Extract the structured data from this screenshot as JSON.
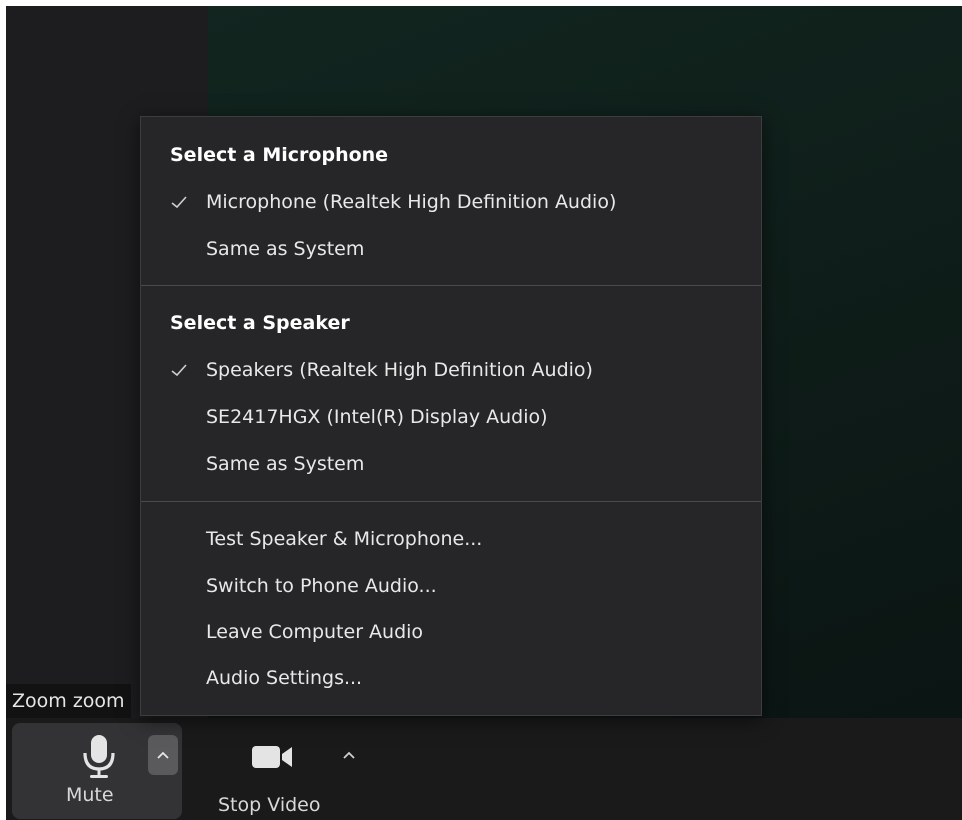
{
  "participant": {
    "name": "Zoom zoom"
  },
  "toolbar": {
    "mute_label": "Mute",
    "stop_video_label": "Stop Video"
  },
  "audio_menu": {
    "microphone_section": {
      "heading": "Select a Microphone",
      "items": [
        {
          "label": "Microphone (Realtek High Definition Audio)",
          "selected": true
        },
        {
          "label": "Same as System",
          "selected": false
        }
      ]
    },
    "speaker_section": {
      "heading": "Select a Speaker",
      "items": [
        {
          "label": "Speakers (Realtek High Definition Audio)",
          "selected": true
        },
        {
          "label": "SE2417HGX (Intel(R) Display Audio)",
          "selected": false
        },
        {
          "label": "Same as System",
          "selected": false
        }
      ]
    },
    "actions": [
      {
        "label": "Test Speaker & Microphone..."
      },
      {
        "label": "Switch to Phone Audio..."
      },
      {
        "label": "Leave Computer Audio"
      },
      {
        "label": "Audio Settings..."
      }
    ]
  },
  "icons": {
    "check": "checkmark-icon",
    "microphone": "microphone-icon",
    "camera": "video-camera-icon",
    "caret": "chevron-up-icon"
  },
  "colors": {
    "menu_background": "#262628",
    "toolbar_background": "#1a1a1a",
    "video_background": "#0f1e1a",
    "text_primary": "#ffffff",
    "text_secondary": "#d8d8d8"
  }
}
